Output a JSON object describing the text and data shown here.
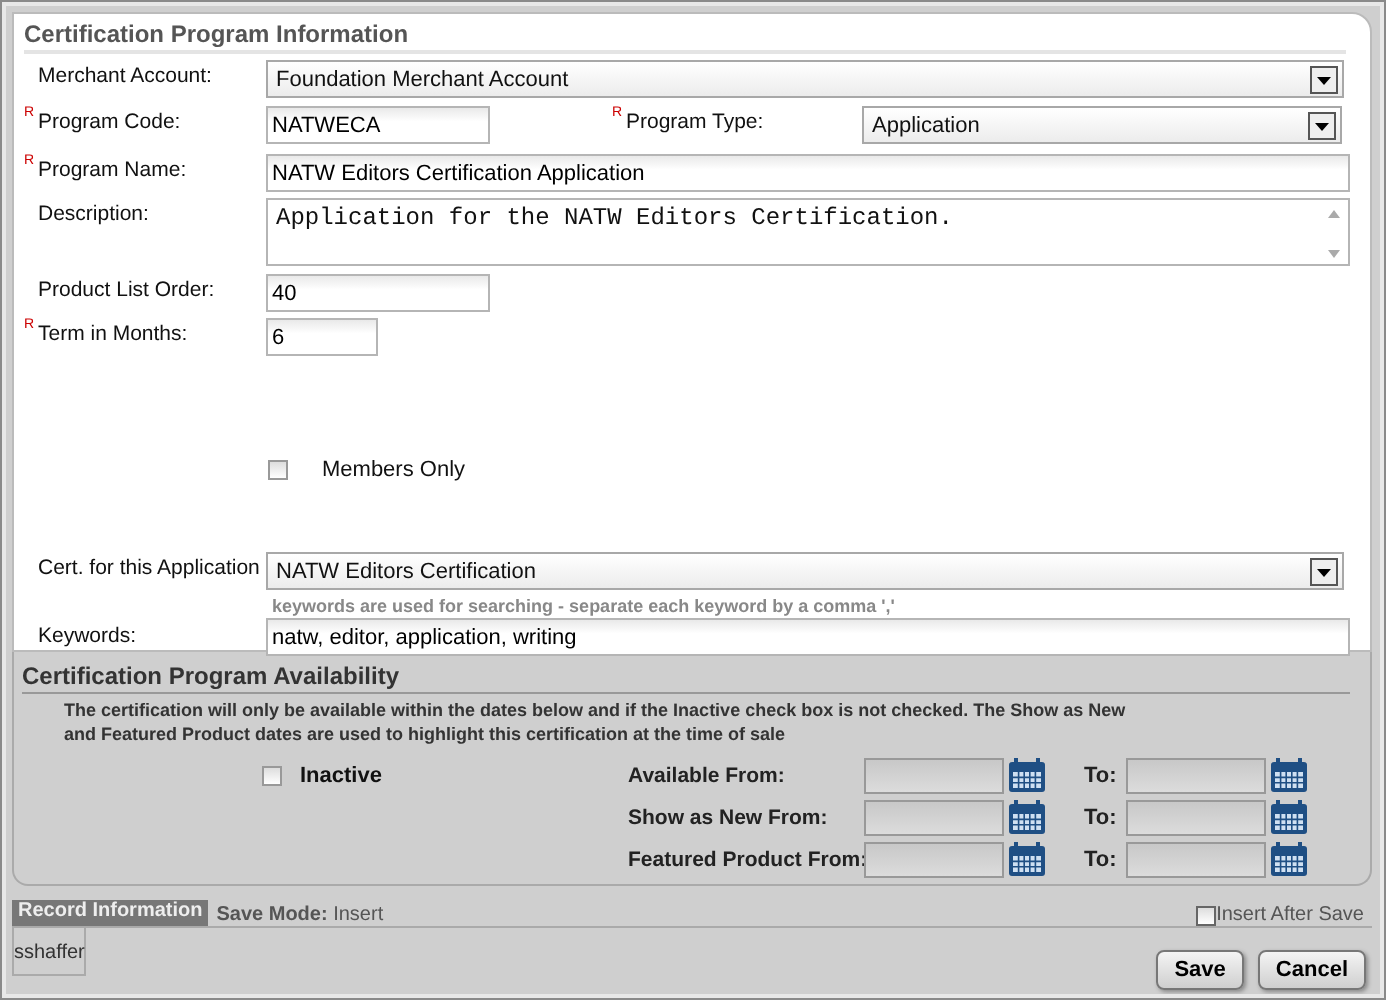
{
  "info": {
    "title": "Certification Program Information",
    "merchant_account": {
      "label": "Merchant Account:",
      "value": "Foundation Merchant Account"
    },
    "program_code": {
      "label": "Program Code:",
      "required_mark": "R",
      "value": "NATWECA"
    },
    "program_type": {
      "label": "Program Type:",
      "required_mark": "R",
      "value": "Application"
    },
    "program_name": {
      "label": "Program Name:",
      "required_mark": "R",
      "value": "NATW Editors Certification Application"
    },
    "description": {
      "label": "Description:",
      "value": "Application for the NATW Editors Certification."
    },
    "product_list_order": {
      "label": "Product List Order:",
      "value": "40"
    },
    "term_in_months": {
      "label": "Term in Months:",
      "required_mark": "R",
      "value": "6"
    },
    "members_only": {
      "label": "Members Only",
      "checked": false
    },
    "cert_for_application": {
      "label": "Cert. for this Application",
      "value": "NATW Editors Certification"
    },
    "keywords": {
      "label": "Keywords:",
      "hint": "keywords are used for searching - separate each keyword by a comma ','",
      "value": "natw, editor, application, writing"
    }
  },
  "availability": {
    "title": "Certification Program Availability",
    "note": "The certification will only be available within the dates below and if the Inactive check box is not checked. The Show as New and Featured Product dates are used to highlight this certification at the time of sale",
    "inactive": {
      "label": "Inactive",
      "checked": false
    },
    "dates": [
      {
        "label": "Available From:",
        "to_label": "To:"
      },
      {
        "label": "Show as New From:",
        "to_label": "To:"
      },
      {
        "label": "Featured Product From:",
        "to_label": "To:"
      }
    ]
  },
  "footer": {
    "record_tab": "Record Information",
    "save_mode": "**Save Mode:** Insert",
    "insert_after_save": {
      "label": "Insert After Save",
      "checked": false
    },
    "user": "sshaffer",
    "buttons": [
      "Save",
      "Cancel"
    ]
  }
}
